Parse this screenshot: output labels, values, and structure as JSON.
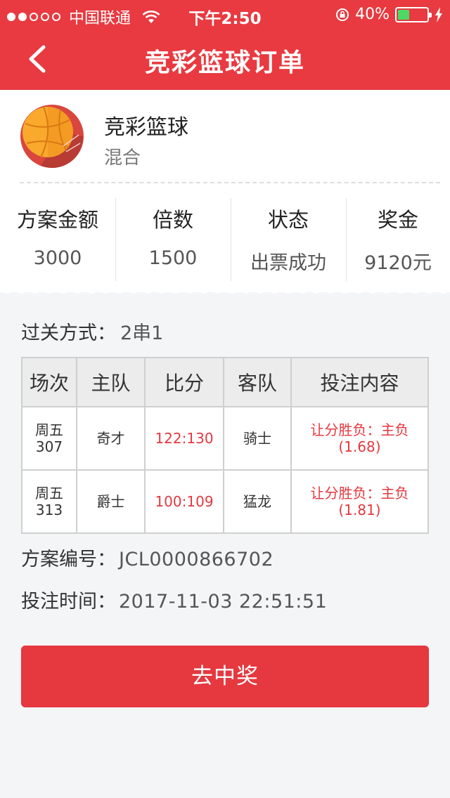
{
  "status_bar": {
    "carrier": "中国联通",
    "signal_bars_filled": 2,
    "signal_bars_total": 5,
    "time": "下午2:50",
    "battery_percent": "40%",
    "battery_level": 0.4
  },
  "nav": {
    "title": "竞彩篮球订单",
    "back_icon": "chevron-left-icon"
  },
  "lottery": {
    "name": "竞彩篮球",
    "type": "混合",
    "icon": "basketball-icon"
  },
  "stats": [
    {
      "label": "方案金额",
      "value": "3000"
    },
    {
      "label": "倍数",
      "value": "1500"
    },
    {
      "label": "状态",
      "value": "出票成功"
    },
    {
      "label": "奖金",
      "value": "9120元"
    }
  ],
  "pass": {
    "label": "过关方式：",
    "value": "2串1"
  },
  "table": {
    "headers": [
      "场次",
      "主队",
      "比分",
      "客队",
      "投注内容"
    ],
    "rows": [
      {
        "match_day": "周五",
        "match_no": "307",
        "home": "奇才",
        "score": "122:130",
        "away": "骑士",
        "bet_line1": "让分胜负：主负",
        "bet_line2": "(1.68)"
      },
      {
        "match_day": "周五",
        "match_no": "313",
        "home": "爵士",
        "score": "100:109",
        "away": "猛龙",
        "bet_line1": "让分胜负：主负",
        "bet_line2": "(1.81)"
      }
    ]
  },
  "plan": {
    "label": "方案编号：",
    "value": "JCL0000866702"
  },
  "bet_time": {
    "label": "投注时间：",
    "value": "2017-11-03 22:51:51"
  },
  "cta": {
    "label": "去中奖"
  },
  "colors": {
    "brand_red": "#e83a40",
    "accent_red": "#e5383f",
    "battery_green": "#4cd964"
  }
}
